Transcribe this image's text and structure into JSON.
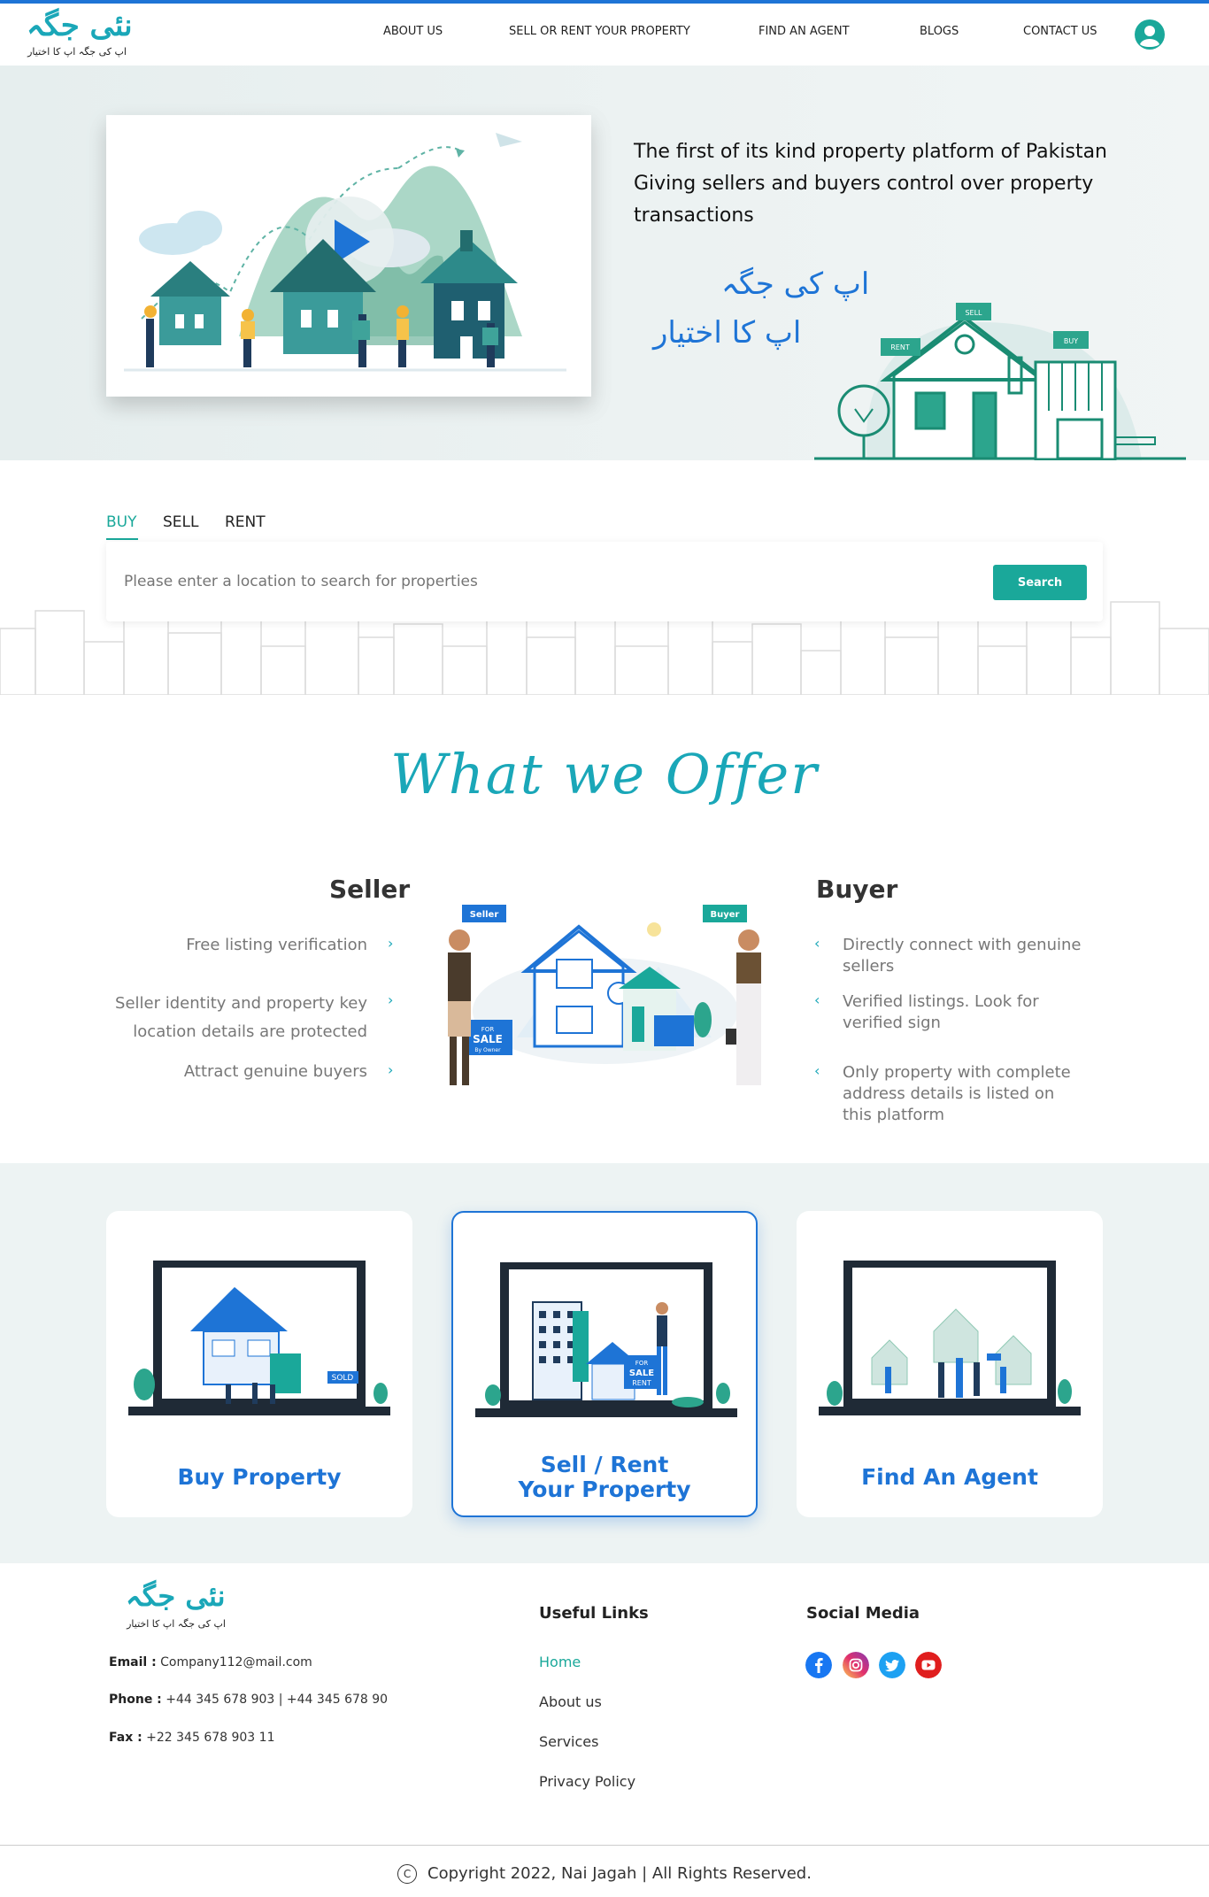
{
  "header": {
    "logo_main": "نئی جگہ",
    "logo_sub": "اپ کی جگہ اپ کا اختیار",
    "nav": [
      "ABOUT US",
      "SELL OR RENT YOUR PROPERTY",
      "FIND AN AGENT",
      "BLOGS",
      "CONTACT US"
    ],
    "user_icon": "user-circle-icon"
  },
  "hero": {
    "line1": "The first of its kind property platform of Pakistan",
    "line2": "Giving sellers and buyers control over property transactions",
    "urdu_line1": "اپ کی جگہ",
    "urdu_line2": "اپ کا اختیار",
    "house_tags": [
      "SELL",
      "RENT",
      "BUY"
    ]
  },
  "search": {
    "tabs": [
      "BUY",
      "SELL",
      "RENT"
    ],
    "active_tab": "BUY",
    "placeholder": "Please enter a location to search for properties",
    "button": "Search"
  },
  "offer": {
    "title": "What we Offer",
    "seller_title": "Seller",
    "buyer_title": "Buyer",
    "seller_items": [
      "Free listing verification",
      "Seller identity and property key location details are protected",
      "Attract genuine buyers"
    ],
    "buyer_items": [
      "Directly connect with genuine sellers",
      "Verified listings. Look for verified sign",
      "Only property with complete address details is listed on this platform"
    ],
    "illus_tags": [
      "Seller",
      "Buyer"
    ],
    "sign_for": "FOR",
    "sign_sale": "SALE",
    "sign_by": "By Owner"
  },
  "cards": [
    {
      "label": "Buy Property",
      "sign": "SOLD"
    },
    {
      "label_line1": "Sell / Rent",
      "label_line2": "Your Property",
      "sign_for": "FOR",
      "sign_sale": "SALE",
      "sign_rent": "RENT"
    },
    {
      "label": "Find An Agent"
    }
  ],
  "footer": {
    "logo_main": "نئی جگہ",
    "logo_sub": "اپ کی جگہ اپ کا اختیار",
    "email_label": "Email :",
    "email": "Company112@mail.com",
    "phone_label": "Phone :",
    "phone": "+44 345 678 903  |  +44 345 678 90",
    "fax_label": "Fax :",
    "fax": "+22 345 678 903 11",
    "useful_links_title": "Useful Links",
    "links": [
      "Home",
      "About us",
      "Services",
      "Privacy Policy"
    ],
    "social_title": "Social Media",
    "social": [
      "facebook-icon",
      "instagram-icon",
      "twitter-icon",
      "youtube-icon"
    ],
    "copyright_symbol": "C",
    "copyright": "Copyright  2022, Nai Jagah |  All Rights Reserved."
  },
  "colors": {
    "brand_blue": "#1e74d6",
    "brand_teal": "#1aa89a",
    "logo_teal": "#1aa7b8"
  }
}
